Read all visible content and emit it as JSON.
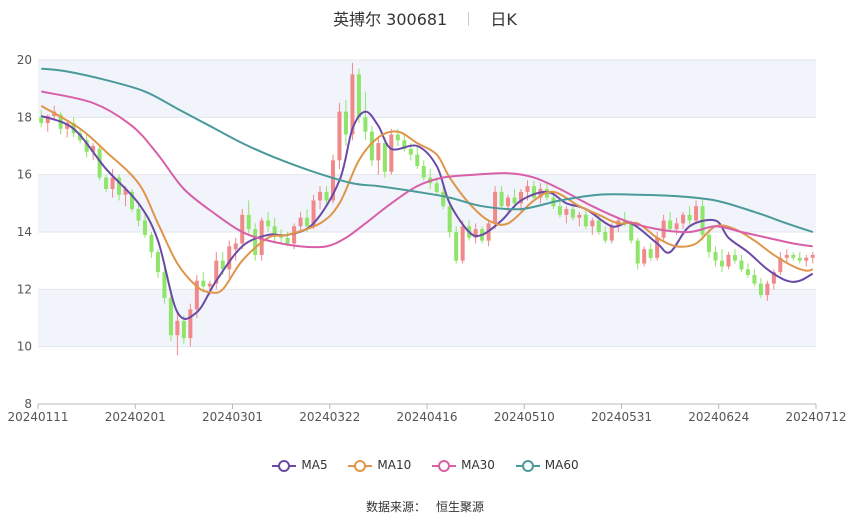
{
  "title": {
    "name": "英搏尔 300681",
    "period": "日K"
  },
  "source": {
    "label": "数据来源：",
    "name": "恒生聚源"
  },
  "colors": {
    "up": "#f08a8a",
    "down": "#8ee56a",
    "MA5": "#6a4aa6",
    "MA10": "#e0954a",
    "MA30": "#d85fa8",
    "MA60": "#4a9a9a",
    "band": "#f2f4fb",
    "grid": "#e3e6ee"
  },
  "chart_data": {
    "type": "candlestick",
    "title": "英搏尔 300681",
    "x_ticks": [
      "20240111",
      "20240201",
      "20240301",
      "20240322",
      "20240416",
      "20240510",
      "20240531",
      "20240624",
      "20240712"
    ],
    "ylim": [
      8,
      20
    ],
    "y_ticks": [
      "8",
      "10",
      "12",
      "14",
      "16",
      "18",
      "20"
    ],
    "num_bars": 120,
    "ohlc": [
      [
        18.0,
        18.25,
        17.65,
        17.8
      ],
      [
        17.8,
        18.1,
        17.5,
        18.05
      ],
      [
        18.05,
        18.4,
        17.9,
        18.2
      ],
      [
        18.1,
        18.2,
        17.4,
        17.6
      ],
      [
        17.6,
        17.9,
        17.3,
        17.8
      ],
      [
        17.8,
        18.0,
        17.3,
        17.45
      ],
      [
        17.45,
        17.6,
        17.1,
        17.2
      ],
      [
        17.2,
        17.4,
        16.6,
        16.8
      ],
      [
        16.8,
        17.1,
        16.5,
        17.0
      ],
      [
        16.9,
        17.0,
        15.8,
        15.9
      ],
      [
        15.9,
        16.0,
        15.4,
        15.5
      ],
      [
        15.5,
        16.2,
        15.2,
        15.9
      ],
      [
        15.9,
        16.0,
        15.1,
        15.3
      ],
      [
        15.3,
        15.6,
        14.9,
        15.5
      ],
      [
        15.4,
        15.5,
        14.7,
        14.8
      ],
      [
        14.8,
        15.0,
        14.2,
        14.4
      ],
      [
        14.4,
        14.6,
        13.8,
        13.9
      ],
      [
        13.9,
        14.0,
        13.1,
        13.3
      ],
      [
        13.3,
        13.4,
        12.4,
        12.6
      ],
      [
        12.6,
        12.8,
        11.5,
        11.7
      ],
      [
        11.7,
        11.9,
        10.2,
        10.4
      ],
      [
        10.4,
        11.2,
        9.7,
        10.9
      ],
      [
        10.9,
        11.1,
        10.1,
        10.3
      ],
      [
        10.3,
        11.5,
        10.0,
        11.3
      ],
      [
        11.3,
        12.5,
        11.0,
        12.3
      ],
      [
        12.3,
        12.6,
        11.9,
        12.1
      ],
      [
        12.1,
        12.3,
        11.8,
        12.2
      ],
      [
        12.2,
        13.3,
        12.0,
        13.0
      ],
      [
        13.0,
        13.3,
        12.5,
        12.7
      ],
      [
        12.7,
        13.7,
        12.4,
        13.5
      ],
      [
        13.4,
        13.8,
        13.0,
        13.6
      ],
      [
        13.6,
        14.8,
        13.4,
        14.6
      ],
      [
        14.6,
        15.1,
        13.9,
        14.1
      ],
      [
        14.1,
        14.3,
        13.0,
        13.2
      ],
      [
        13.2,
        14.5,
        13.0,
        14.4
      ],
      [
        14.4,
        14.7,
        14.0,
        14.2
      ],
      [
        14.2,
        14.5,
        13.6,
        13.9
      ],
      [
        13.9,
        14.1,
        13.6,
        13.8
      ],
      [
        13.8,
        14.0,
        13.5,
        13.6
      ],
      [
        13.6,
        14.3,
        13.4,
        14.2
      ],
      [
        14.2,
        14.7,
        14.0,
        14.5
      ],
      [
        14.5,
        14.8,
        14.0,
        14.2
      ],
      [
        14.2,
        15.3,
        14.1,
        15.1
      ],
      [
        15.1,
        15.6,
        14.8,
        15.4
      ],
      [
        15.4,
        15.6,
        14.9,
        15.1
      ],
      [
        15.1,
        16.7,
        15.0,
        16.5
      ],
      [
        16.5,
        18.5,
        16.2,
        18.2
      ],
      [
        18.2,
        18.6,
        17.0,
        17.4
      ],
      [
        17.4,
        19.9,
        17.2,
        19.5
      ],
      [
        19.5,
        19.7,
        17.8,
        18.0
      ],
      [
        18.0,
        18.9,
        17.2,
        17.5
      ],
      [
        17.5,
        17.7,
        16.3,
        16.5
      ],
      [
        16.5,
        17.3,
        16.0,
        17.1
      ],
      [
        17.1,
        17.3,
        15.9,
        16.1
      ],
      [
        16.1,
        17.6,
        16.0,
        17.4
      ],
      [
        17.4,
        17.6,
        17.0,
        17.2
      ],
      [
        17.2,
        17.4,
        16.8,
        16.9
      ],
      [
        16.9,
        17.1,
        16.5,
        16.7
      ],
      [
        16.7,
        17.0,
        16.2,
        16.3
      ],
      [
        16.3,
        16.5,
        15.8,
        15.9
      ],
      [
        15.9,
        16.2,
        15.5,
        15.7
      ],
      [
        15.7,
        15.9,
        15.3,
        15.4
      ],
      [
        15.4,
        15.6,
        14.8,
        14.9
      ],
      [
        14.9,
        15.1,
        13.8,
        14.0
      ],
      [
        14.0,
        14.2,
        12.9,
        13.0
      ],
      [
        13.0,
        14.4,
        12.9,
        14.2
      ],
      [
        14.2,
        14.4,
        13.7,
        13.8
      ],
      [
        13.8,
        14.3,
        13.6,
        14.1
      ],
      [
        14.1,
        14.2,
        13.6,
        13.7
      ],
      [
        13.7,
        14.4,
        13.5,
        14.3
      ],
      [
        14.3,
        15.6,
        14.1,
        15.4
      ],
      [
        15.4,
        15.6,
        14.8,
        14.9
      ],
      [
        14.9,
        15.3,
        14.7,
        15.2
      ],
      [
        15.2,
        15.5,
        14.8,
        15.0
      ],
      [
        15.0,
        15.5,
        14.7,
        15.4
      ],
      [
        15.4,
        15.8,
        15.1,
        15.6
      ],
      [
        15.6,
        15.8,
        15.1,
        15.2
      ],
      [
        15.2,
        15.7,
        15.0,
        15.5
      ],
      [
        15.5,
        15.7,
        15.1,
        15.2
      ],
      [
        15.2,
        15.4,
        14.8,
        14.9
      ],
      [
        14.9,
        15.1,
        14.5,
        14.6
      ],
      [
        14.6,
        14.9,
        14.3,
        14.8
      ],
      [
        14.8,
        15.0,
        14.4,
        14.5
      ],
      [
        14.5,
        14.7,
        14.2,
        14.6
      ],
      [
        14.6,
        14.8,
        14.1,
        14.2
      ],
      [
        14.2,
        14.5,
        13.9,
        14.4
      ],
      [
        14.4,
        14.6,
        13.9,
        14.0
      ],
      [
        14.0,
        14.2,
        13.6,
        13.7
      ],
      [
        13.7,
        14.3,
        13.6,
        14.2
      ],
      [
        14.2,
        14.5,
        14.0,
        14.4
      ],
      [
        14.4,
        14.7,
        14.2,
        14.3
      ],
      [
        14.3,
        14.4,
        13.6,
        13.7
      ],
      [
        13.7,
        13.8,
        12.7,
        12.9
      ],
      [
        12.9,
        13.5,
        12.8,
        13.4
      ],
      [
        13.4,
        13.6,
        13.0,
        13.1
      ],
      [
        13.1,
        14.0,
        13.0,
        13.8
      ],
      [
        13.8,
        14.6,
        13.7,
        14.4
      ],
      [
        14.4,
        14.7,
        14.0,
        14.1
      ],
      [
        14.1,
        14.5,
        13.9,
        14.3
      ],
      [
        14.3,
        14.7,
        14.1,
        14.6
      ],
      [
        14.6,
        14.9,
        14.2,
        14.4
      ],
      [
        14.4,
        15.1,
        14.3,
        14.9
      ],
      [
        14.9,
        15.2,
        13.7,
        13.9
      ],
      [
        13.9,
        14.1,
        13.1,
        13.3
      ],
      [
        13.3,
        13.5,
        12.8,
        13.0
      ],
      [
        13.0,
        13.4,
        12.6,
        12.8
      ],
      [
        12.8,
        13.3,
        12.7,
        13.2
      ],
      [
        13.2,
        13.4,
        12.9,
        13.0
      ],
      [
        13.0,
        13.2,
        12.6,
        12.7
      ],
      [
        12.7,
        12.9,
        12.4,
        12.5
      ],
      [
        12.5,
        12.7,
        12.1,
        12.2
      ],
      [
        12.2,
        12.4,
        11.7,
        11.8
      ],
      [
        11.8,
        12.3,
        11.6,
        12.2
      ],
      [
        12.2,
        12.7,
        12.0,
        12.6
      ],
      [
        12.6,
        13.3,
        12.5,
        13.1
      ],
      [
        13.1,
        13.4,
        12.9,
        13.2
      ],
      [
        13.2,
        13.3,
        13.0,
        13.1
      ],
      [
        13.1,
        13.3,
        12.9,
        13.0
      ],
      [
        13.0,
        13.2,
        12.8,
        13.1
      ],
      [
        13.1,
        13.3,
        12.9,
        13.2
      ]
    ],
    "series": [
      {
        "name": "MA5",
        "knots": [
          [
            0,
            18.05
          ],
          [
            5,
            17.6
          ],
          [
            10,
            16.2
          ],
          [
            15,
            15.0
          ],
          [
            18,
            13.7
          ],
          [
            21,
            11.2
          ],
          [
            24,
            11.2
          ],
          [
            27,
            12.3
          ],
          [
            31,
            13.5
          ],
          [
            35,
            13.9
          ],
          [
            38,
            13.9
          ],
          [
            42,
            14.3
          ],
          [
            46,
            15.8
          ],
          [
            48,
            17.6
          ],
          [
            50,
            18.2
          ],
          [
            52,
            17.7
          ],
          [
            54,
            16.9
          ],
          [
            58,
            17.0
          ],
          [
            61,
            16.3
          ],
          [
            63,
            15.0
          ],
          [
            66,
            14.0
          ],
          [
            68,
            13.9
          ],
          [
            71,
            14.4
          ],
          [
            74,
            15.1
          ],
          [
            78,
            15.4
          ],
          [
            81,
            15.0
          ],
          [
            84,
            14.8
          ],
          [
            88,
            14.2
          ],
          [
            91,
            14.3
          ],
          [
            95,
            13.6
          ],
          [
            97,
            13.3
          ],
          [
            100,
            14.2
          ],
          [
            104,
            14.4
          ],
          [
            106,
            13.8
          ],
          [
            109,
            13.3
          ],
          [
            112,
            12.7
          ],
          [
            115,
            12.3
          ],
          [
            117,
            12.3
          ],
          [
            119,
            12.55
          ]
        ]
      },
      {
        "name": "MA10",
        "knots": [
          [
            0,
            18.4
          ],
          [
            6,
            17.6
          ],
          [
            10,
            16.8
          ],
          [
            15,
            15.7
          ],
          [
            18,
            14.3
          ],
          [
            21,
            12.9
          ],
          [
            24,
            12.1
          ],
          [
            26,
            11.9
          ],
          [
            28,
            12.0
          ],
          [
            31,
            13.0
          ],
          [
            35,
            13.8
          ],
          [
            38,
            13.9
          ],
          [
            43,
            14.3
          ],
          [
            46,
            15.0
          ],
          [
            49,
            16.5
          ],
          [
            52,
            17.3
          ],
          [
            55,
            17.5
          ],
          [
            58,
            17.1
          ],
          [
            61,
            16.7
          ],
          [
            63,
            15.9
          ],
          [
            66,
            15.0
          ],
          [
            69,
            14.4
          ],
          [
            72,
            14.3
          ],
          [
            76,
            15.1
          ],
          [
            79,
            15.4
          ],
          [
            83,
            14.9
          ],
          [
            86,
            14.6
          ],
          [
            89,
            14.3
          ],
          [
            92,
            14.3
          ],
          [
            95,
            13.8
          ],
          [
            98,
            13.5
          ],
          [
            101,
            13.6
          ],
          [
            104,
            14.2
          ],
          [
            107,
            14.1
          ],
          [
            110,
            13.7
          ],
          [
            113,
            13.2
          ],
          [
            116,
            12.8
          ],
          [
            118,
            12.65
          ],
          [
            119,
            12.7
          ]
        ]
      },
      {
        "name": "MA30",
        "knots": [
          [
            0,
            18.9
          ],
          [
            8,
            18.5
          ],
          [
            14,
            17.7
          ],
          [
            18,
            16.7
          ],
          [
            22,
            15.5
          ],
          [
            27,
            14.6
          ],
          [
            31,
            14.0
          ],
          [
            35,
            13.7
          ],
          [
            40,
            13.5
          ],
          [
            44,
            13.5
          ],
          [
            47,
            13.8
          ],
          [
            50,
            14.3
          ],
          [
            54,
            15.0
          ],
          [
            58,
            15.6
          ],
          [
            62,
            15.9
          ],
          [
            67,
            16.0
          ],
          [
            72,
            16.05
          ],
          [
            76,
            15.9
          ],
          [
            80,
            15.5
          ],
          [
            85,
            14.9
          ],
          [
            90,
            14.4
          ],
          [
            95,
            14.1
          ],
          [
            100,
            14.0
          ],
          [
            104,
            14.2
          ],
          [
            108,
            14.0
          ],
          [
            112,
            13.8
          ],
          [
            116,
            13.6
          ],
          [
            119,
            13.5
          ]
        ]
      },
      {
        "name": "MA60",
        "knots": [
          [
            0,
            19.7
          ],
          [
            4,
            19.6
          ],
          [
            10,
            19.3
          ],
          [
            16,
            18.9
          ],
          [
            21,
            18.3
          ],
          [
            26,
            17.7
          ],
          [
            31,
            17.1
          ],
          [
            36,
            16.6
          ],
          [
            42,
            16.1
          ],
          [
            48,
            15.7
          ],
          [
            52,
            15.6
          ],
          [
            58,
            15.4
          ],
          [
            63,
            15.2
          ],
          [
            68,
            14.9
          ],
          [
            74,
            14.8
          ],
          [
            80,
            15.1
          ],
          [
            86,
            15.3
          ],
          [
            92,
            15.3
          ],
          [
            98,
            15.25
          ],
          [
            104,
            15.1
          ],
          [
            110,
            14.7
          ],
          [
            115,
            14.3
          ],
          [
            119,
            14.0
          ]
        ]
      }
    ],
    "legend": [
      "MA5",
      "MA10",
      "MA30",
      "MA60"
    ],
    "legend_position": "bottom",
    "grid": true
  }
}
